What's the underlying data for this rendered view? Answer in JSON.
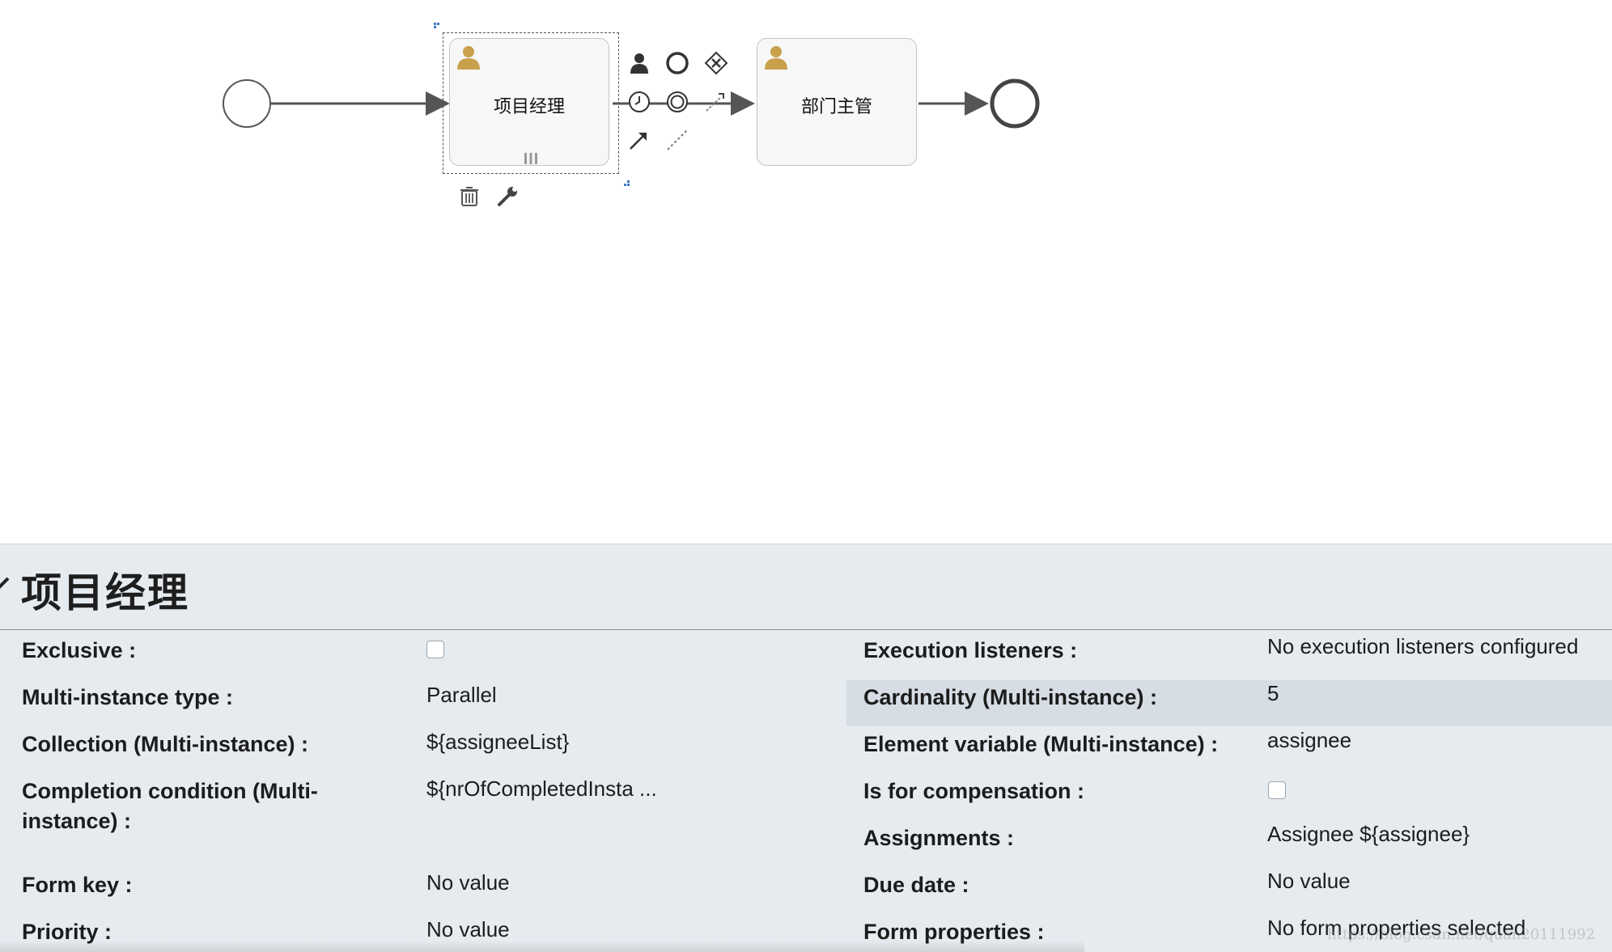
{
  "diagram": {
    "tasks": [
      {
        "id": "task-manager",
        "label": "项目经理",
        "selected": true
      },
      {
        "id": "task-dept",
        "label": "部门主管",
        "selected": false
      }
    ],
    "palette_icons": [
      "user-task-icon",
      "end-event-icon",
      "exclusive-gateway-icon",
      "timer-event-icon",
      "intermediate-event-icon",
      "sequence-flow-icon",
      "association-icon",
      "dashed-association-icon",
      "delete-icon",
      "wrench-icon"
    ]
  },
  "panel": {
    "title": "项目经理",
    "left_properties": [
      {
        "label": "Exclusive :",
        "value": "",
        "type": "checkbox",
        "checked": false
      },
      {
        "label": "Multi-instance type :",
        "value": "Parallel",
        "type": "text"
      },
      {
        "label": "Collection (Multi-instance) :",
        "value": "${assigneeList}",
        "type": "text"
      },
      {
        "label_line1": "Completion condition (Multi-",
        "label_line2": "instance) :",
        "value": "${nrOfCompletedInsta ...",
        "type": "text"
      },
      {
        "label": "Form key :",
        "value": "No value",
        "type": "text"
      },
      {
        "label": "Priority :",
        "value": "No value",
        "type": "text"
      }
    ],
    "right_properties": [
      {
        "label": "Execution listeners :",
        "value": "No execution listeners configured",
        "type": "text"
      },
      {
        "label": "Cardinality (Multi-instance) :",
        "value": "5",
        "type": "text",
        "highlighted": true
      },
      {
        "label": "Element variable (Multi-instance) :",
        "value": "assignee",
        "type": "text"
      },
      {
        "label": "Is for compensation :",
        "value": "",
        "type": "checkbox",
        "checked": false
      },
      {
        "label": "Assignments :",
        "value": "Assignee ${assignee}",
        "type": "text"
      },
      {
        "label": "Due date :",
        "value": "No value",
        "type": "text"
      },
      {
        "label": "Form properties :",
        "value": "No form properties selected",
        "type": "text"
      }
    ],
    "watermark": "https://blog.csdn.net/quan20111992"
  },
  "colors": {
    "user_icon": "#c9a04c",
    "panel_bg": "#e6ebf0",
    "highlight_row": "#d6dde5",
    "handle": "#3c78c4"
  }
}
